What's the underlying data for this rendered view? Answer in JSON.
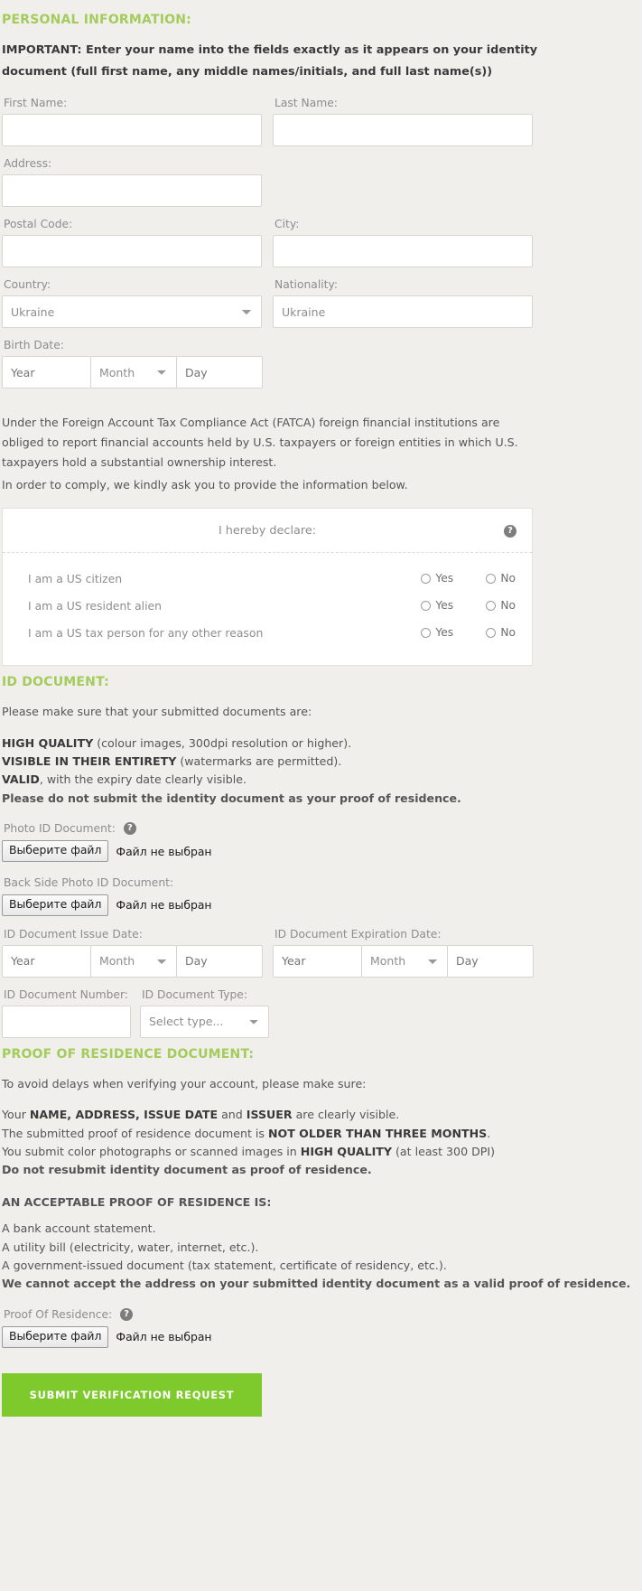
{
  "personal": {
    "heading": "PERSONAL INFORMATION:",
    "important_note": "IMPORTANT: Enter your name into the fields exactly as it appears on your identity document (full first name, any middle names/initials, and full last name(s))",
    "first_name_label": "First Name:",
    "first_name_value": "",
    "last_name_label": "Last Name:",
    "last_name_value": "",
    "address_label": "Address:",
    "address_value": "",
    "postal_code_label": "Postal Code:",
    "postal_code_value": "",
    "city_label": "City:",
    "city_value": "",
    "country_label": "Country:",
    "country_value": "Ukraine",
    "nationality_label": "Nationality:",
    "nationality_value": "Ukraine",
    "birth_date_label": "Birth Date:",
    "birth_year": "Year",
    "birth_month": "Month",
    "birth_day": "Day"
  },
  "fatca": {
    "paragraph_1": "Under the Foreign Account Tax Compliance Act (FATCA) foreign financial institutions are obliged to report financial accounts held by U.S. taxpayers or foreign entities in which U.S. taxpayers hold a substantial ownership interest.",
    "paragraph_2": "In order to comply, we kindly ask you to provide the information below.",
    "declare_title": "I hereby declare:",
    "help_icon": "?",
    "yes_label": "Yes",
    "no_label": "No",
    "questions": [
      {
        "text": "I am a US citizen"
      },
      {
        "text": "I am a US resident alien"
      },
      {
        "text": "I am a US tax person for any other reason"
      }
    ]
  },
  "id_document": {
    "heading": "ID DOCUMENT:",
    "intro": "Please make sure that your submitted documents are:",
    "req_1_bold": "HIGH QUALITY",
    "req_1_rest": " (colour images, 300dpi resolution or higher).",
    "req_2_bold": "VISIBLE IN THEIR ENTIRETY",
    "req_2_rest": " (watermarks are permitted).",
    "req_3_bold": "VALID",
    "req_3_rest": ", with the expiry date clearly visible.",
    "warning": "Please do not submit the identity document as your proof of residence.",
    "photo_id_label": "Photo ID Document:",
    "back_side_label": "Back Side Photo ID Document:",
    "file_button": "Выберите файл",
    "file_status": "Файл не выбран",
    "issue_date_label": "ID Document Issue Date:",
    "expiration_date_label": "ID Document Expiration Date:",
    "issue_year": "Year",
    "issue_month": "Month",
    "issue_day": "Day",
    "exp_year": "Year",
    "exp_month": "Month",
    "exp_day": "Day",
    "number_label": "ID Document Number:",
    "number_value": "",
    "type_label": "ID Document Type:",
    "type_value": "Select type..."
  },
  "proof_of_residence": {
    "heading": "PROOF OF RESIDENCE DOCUMENT:",
    "intro": "To avoid delays when verifying your account, please make sure:",
    "line_1_pre": "Your ",
    "line_1_bold": "NAME, ADDRESS, ISSUE DATE",
    "line_1_mid": " and ",
    "line_1_bold2": "ISSUER",
    "line_1_post": " are clearly visible.",
    "line_2_pre": "The submitted proof of residence document is ",
    "line_2_bold": "NOT OLDER THAN THREE MONTHS",
    "line_2_post": ".",
    "line_3_pre": "You submit color photographs or scanned images in ",
    "line_3_bold": "HIGH QUALITY",
    "line_3_post": " (at least 300 DPI)",
    "warning": "Do not resubmit identity document as proof of residence.",
    "acceptable_heading": "AN ACCEPTABLE PROOF OF RESIDENCE IS:",
    "acceptable_items": [
      "A bank account statement.",
      "A utility bill (electricity, water, internet, etc.).",
      "A government-issued document (tax statement, certificate of residency, etc.)."
    ],
    "final_warning": "We cannot accept the address on your submitted identity document as a valid proof of residence.",
    "file_label": "Proof Of Residence:",
    "file_button": "Выберите файл",
    "file_status": "Файл не выбран"
  },
  "submit": {
    "label": "SUBMIT VERIFICATION REQUEST"
  },
  "colors": {
    "accent_green": "#a3cc5b",
    "button_green": "#7ec92b",
    "warning_red": "#c4443a",
    "background": "#f1efec"
  }
}
